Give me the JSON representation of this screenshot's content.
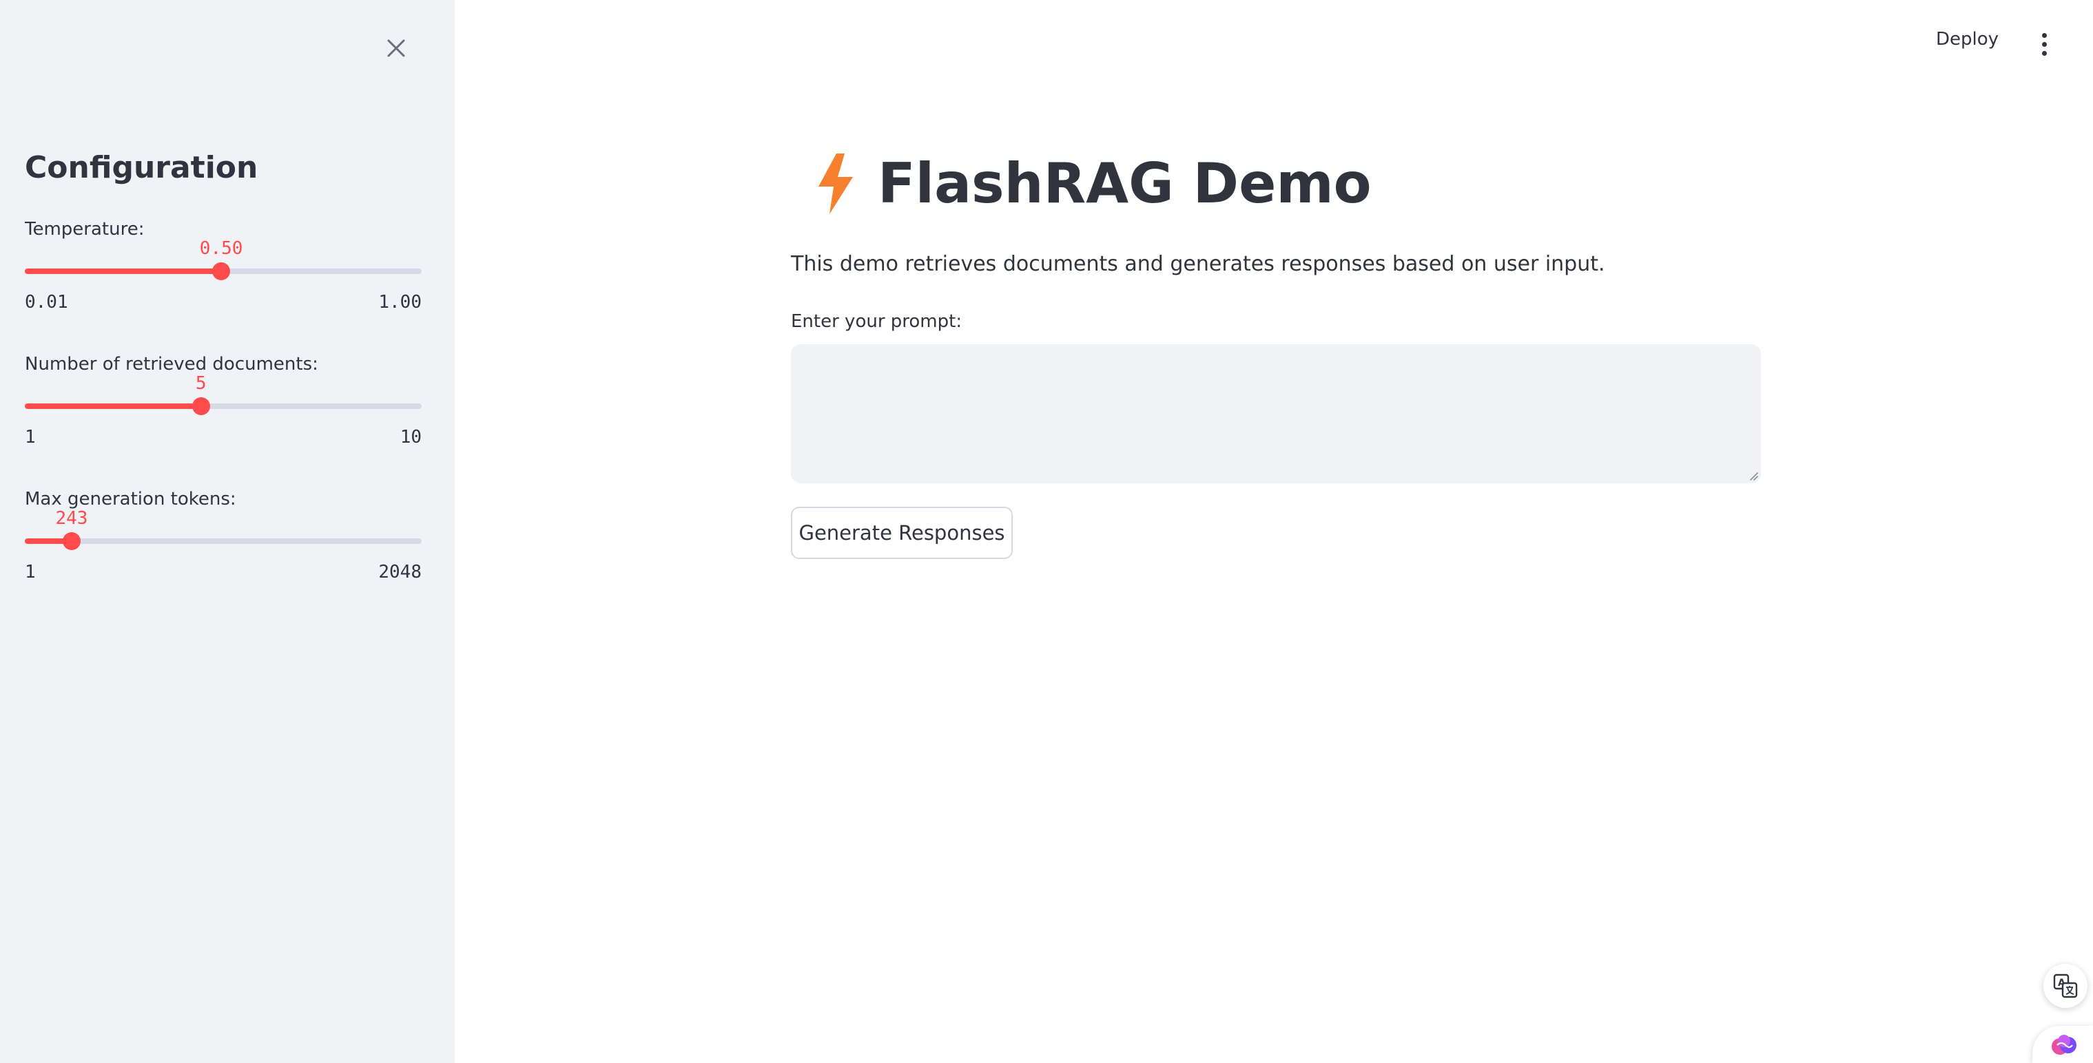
{
  "sidebar": {
    "title": "Configuration",
    "sliders": [
      {
        "label": "Temperature:",
        "value": "0.50",
        "min": "0.01",
        "max": "1.00",
        "fraction": 0.495
      },
      {
        "label": "Number of retrieved documents:",
        "value": "5",
        "min": "1",
        "max": "10",
        "fraction": 0.444
      },
      {
        "label": "Max generation tokens:",
        "value": "243",
        "min": "1",
        "max": "2048",
        "fraction": 0.118
      }
    ]
  },
  "header": {
    "deploy_label": "Deploy"
  },
  "main": {
    "title": "FlashRAG Demo",
    "description": "This demo retrieves documents and generates responses based on user input.",
    "prompt_label": "Enter your prompt:",
    "prompt_value": "",
    "generate_label": "Generate Responses"
  },
  "icons": {
    "close": "close-icon",
    "menu": "more-vertical-icon",
    "title": "lightning-bolt-icon",
    "translate": "translate-icon",
    "assistant": "brain-icon"
  },
  "colors": {
    "accent": "#ff4b4b",
    "sidebar_bg": "#f0f2f6",
    "text": "#31333f",
    "bolt": "#f7802e"
  }
}
